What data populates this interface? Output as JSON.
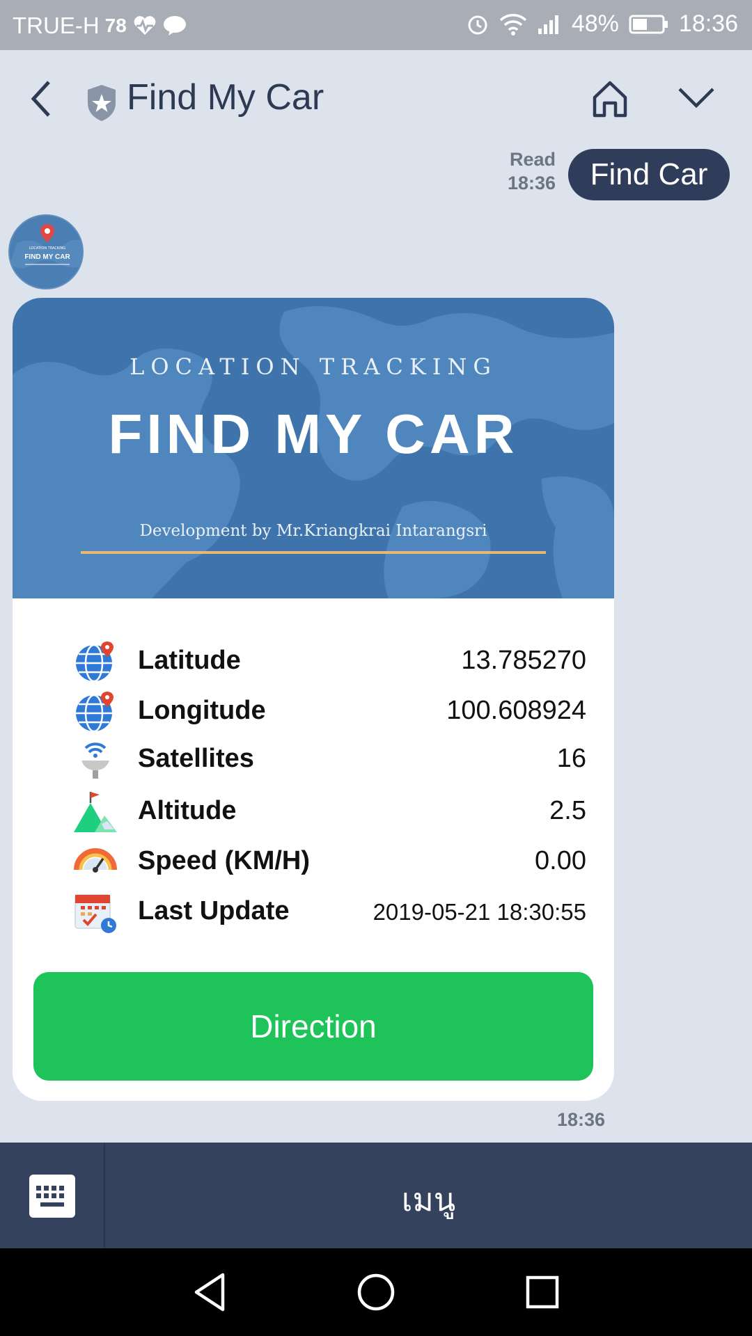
{
  "status_bar": {
    "carrier": "TRUE-H",
    "signal_number": "78",
    "battery_percent": "48%",
    "time": "18:36"
  },
  "header": {
    "title": "Find My Car"
  },
  "sent_message": {
    "read_label": "Read",
    "read_time": "18:36",
    "text": "Find Car"
  },
  "card": {
    "banner": {
      "subtitle": "LOCATION TRACKING",
      "title": "FIND MY CAR",
      "developer": "Development by Mr.Kriangkrai Intarangsri"
    },
    "rows": [
      {
        "label": "Latitude",
        "value": "13.785270",
        "icon": "globe-pin-icon"
      },
      {
        "label": "Longitude",
        "value": "100.608924",
        "icon": "globe-pin-icon"
      },
      {
        "label": "Satellites",
        "value": "16",
        "icon": "satellite-dish-icon"
      },
      {
        "label": "Altitude",
        "value": "2.5",
        "icon": "mountain-flag-icon"
      },
      {
        "label": "Speed (KM/H)",
        "value": "0.00",
        "icon": "speedometer-icon"
      },
      {
        "label": "Last Update",
        "value": "2019-05-21 18:30:55",
        "icon": "calendar-clock-icon"
      }
    ],
    "button_label": "Direction",
    "time": "18:36"
  },
  "avatar": {
    "subtitle": "LOCATION TRACKING",
    "title": "FIND MY CAR"
  },
  "menu_bar": {
    "label": "เมนู"
  },
  "colors": {
    "background": "#dde3ec",
    "sent_bubble": "#2f3c5a",
    "banner": "#3e74ab",
    "button": "#1ec45a",
    "menu_bar": "#34425d"
  }
}
